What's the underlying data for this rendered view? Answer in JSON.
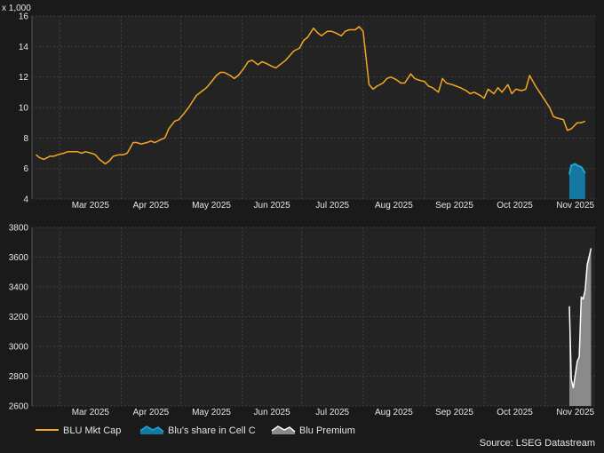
{
  "chart_data": [
    {
      "type": "line",
      "multiplier_label": "x 1,000",
      "ylim": [
        4,
        16
      ],
      "y_ticks": [
        "4",
        "6",
        "8",
        "10",
        "12",
        "14",
        "16"
      ],
      "x_tick_labels": [
        "Mar 2025",
        "Apr 2025",
        "May 2025",
        "Jun 2025",
        "Jul 2025",
        "Aug 2025",
        "Sep 2025",
        "Oct 2025",
        "Nov 2025"
      ],
      "grid": true,
      "series": [
        {
          "name": "BLU Mkt Cap",
          "color": "#f5a623",
          "x": [
            "2025-02-17",
            "2025-02-19",
            "2025-02-21",
            "2025-02-24",
            "2025-02-26",
            "2025-02-28",
            "2025-03-03",
            "2025-03-05",
            "2025-03-07",
            "2025-03-10",
            "2025-03-12",
            "2025-03-14",
            "2025-03-17",
            "2025-03-19",
            "2025-03-21",
            "2025-03-24",
            "2025-03-26",
            "2025-03-28",
            "2025-03-31",
            "2025-04-02",
            "2025-04-04",
            "2025-04-07",
            "2025-04-09",
            "2025-04-11",
            "2025-04-14",
            "2025-04-16",
            "2025-04-18",
            "2025-04-21",
            "2025-04-23",
            "2025-04-25",
            "2025-04-28",
            "2025-04-30",
            "2025-05-02",
            "2025-05-05",
            "2025-05-07",
            "2025-05-09",
            "2025-05-12",
            "2025-05-14",
            "2025-05-16",
            "2025-05-19",
            "2025-05-21",
            "2025-05-23",
            "2025-05-26",
            "2025-05-28",
            "2025-05-30",
            "2025-06-02",
            "2025-06-04",
            "2025-06-06",
            "2025-06-09",
            "2025-06-11",
            "2025-06-13",
            "2025-06-16",
            "2025-06-18",
            "2025-06-20",
            "2025-06-23",
            "2025-06-25",
            "2025-06-27",
            "2025-06-30",
            "2025-07-02",
            "2025-07-04",
            "2025-07-07",
            "2025-07-09",
            "2025-07-11",
            "2025-07-14",
            "2025-07-16",
            "2025-07-18",
            "2025-07-21",
            "2025-07-23",
            "2025-07-25",
            "2025-07-28",
            "2025-07-30",
            "2025-08-01",
            "2025-08-04",
            "2025-08-06",
            "2025-08-08",
            "2025-08-11",
            "2025-08-13",
            "2025-08-15",
            "2025-08-18",
            "2025-08-20",
            "2025-08-22",
            "2025-08-25",
            "2025-08-27",
            "2025-08-29",
            "2025-09-01",
            "2025-09-03",
            "2025-09-05",
            "2025-09-08",
            "2025-09-10",
            "2025-09-12",
            "2025-09-15",
            "2025-09-17",
            "2025-09-19",
            "2025-09-22",
            "2025-09-24",
            "2025-09-26",
            "2025-09-29",
            "2025-10-01",
            "2025-10-03",
            "2025-10-06",
            "2025-10-08",
            "2025-10-10",
            "2025-10-13",
            "2025-10-15",
            "2025-10-17",
            "2025-10-20",
            "2025-10-22",
            "2025-10-24",
            "2025-10-27",
            "2025-10-29",
            "2025-10-31",
            "2025-11-03",
            "2025-11-05",
            "2025-11-07",
            "2025-11-10",
            "2025-11-12",
            "2025-11-14",
            "2025-11-17",
            "2025-11-19",
            "2025-11-21"
          ],
          "values": [
            6.9,
            6.7,
            6.6,
            6.8,
            6.8,
            6.9,
            7.0,
            7.1,
            7.1,
            7.1,
            7.0,
            7.1,
            7.0,
            6.9,
            6.6,
            6.3,
            6.5,
            6.8,
            6.9,
            6.9,
            7.0,
            7.7,
            7.7,
            7.6,
            7.7,
            7.8,
            7.7,
            7.9,
            8.0,
            8.6,
            9.1,
            9.2,
            9.5,
            10.0,
            10.4,
            10.8,
            11.1,
            11.3,
            11.6,
            12.1,
            12.3,
            12.3,
            12.1,
            11.9,
            12.1,
            12.6,
            13.0,
            13.1,
            12.8,
            13.0,
            12.9,
            12.7,
            12.6,
            12.8,
            13.1,
            13.4,
            13.7,
            13.9,
            14.4,
            14.6,
            15.2,
            14.9,
            14.7,
            15.0,
            15.0,
            14.9,
            14.7,
            15.0,
            15.1,
            15.1,
            15.3,
            15.0,
            11.5,
            11.2,
            11.4,
            11.6,
            11.9,
            12.0,
            11.8,
            11.6,
            11.6,
            12.2,
            11.9,
            11.8,
            11.7,
            11.4,
            11.3,
            11.0,
            11.9,
            11.6,
            11.5,
            11.4,
            11.3,
            11.1,
            10.9,
            11.0,
            10.8,
            10.6,
            11.2,
            10.9,
            11.3,
            11.0,
            11.5,
            10.9,
            11.2,
            11.1,
            11.2,
            12.1,
            11.4,
            11.0,
            10.6,
            10.0,
            9.4,
            9.3,
            9.2,
            8.5,
            8.6,
            9.0,
            9.0,
            9.1
          ]
        },
        {
          "name": "Blu's share in Cell C",
          "color": "#1ea7d6",
          "x": [
            "2025-11-13",
            "2025-11-14",
            "2025-11-16",
            "2025-11-17",
            "2025-11-19",
            "2025-11-21"
          ],
          "values": [
            5.6,
            6.2,
            6.3,
            6.2,
            6.1,
            5.7
          ]
        }
      ]
    },
    {
      "type": "area",
      "ylim": [
        2600,
        3800
      ],
      "y_ticks": [
        "2600",
        "2800",
        "3000",
        "3200",
        "3400",
        "3600",
        "3800"
      ],
      "x_tick_labels": [
        "Mar 2025",
        "Apr 2025",
        "May 2025",
        "Jun 2025",
        "Jul 2025",
        "Aug 2025",
        "Sep 2025",
        "Oct 2025",
        "Nov 2025"
      ],
      "grid": true,
      "series": [
        {
          "name": "Blu Premium",
          "color": "#ffffff",
          "x": [
            "2025-11-13",
            "2025-11-14",
            "2025-11-15",
            "2025-11-17",
            "2025-11-18",
            "2025-11-19",
            "2025-11-20",
            "2025-11-21",
            "2025-11-22",
            "2025-11-24"
          ],
          "values": [
            3270,
            2780,
            2720,
            2900,
            2930,
            3330,
            3320,
            3380,
            3550,
            3660
          ]
        }
      ]
    }
  ],
  "legend": [
    {
      "label": "BLU Mkt Cap",
      "color": "#f5a623",
      "icon": "line-icon"
    },
    {
      "label": "Blu's share in Cell C",
      "color": "#1ea7d6",
      "icon": "area-icon"
    },
    {
      "label": "Blu Premium",
      "color": "#ffffff",
      "icon": "area-icon"
    }
  ],
  "source": "Source: LSEG Datastream"
}
